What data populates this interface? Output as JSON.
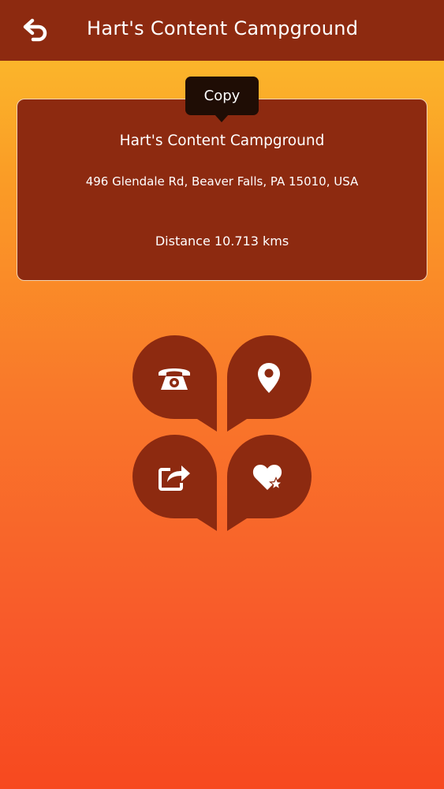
{
  "app_bar": {
    "title": "Hart's Content Campground",
    "back_icon": "undo-arrow-icon"
  },
  "place": {
    "name": "Hart's Content Campground",
    "address": "496 Glendale Rd, Beaver Falls, PA 15010, USA",
    "distance": "Distance 10.713 kms"
  },
  "tooltip": {
    "label": "Copy"
  },
  "actions": [
    {
      "icon": "telephone-icon"
    },
    {
      "icon": "location-pin-icon"
    },
    {
      "icon": "share-icon"
    },
    {
      "icon": "heart-star-icon"
    }
  ],
  "colors": {
    "primary": "#8d2a10",
    "gradient_top": "#fcc22d",
    "gradient_bottom": "#f7491f",
    "tooltip_bg": "#1f0d05",
    "text": "#ffffff"
  }
}
